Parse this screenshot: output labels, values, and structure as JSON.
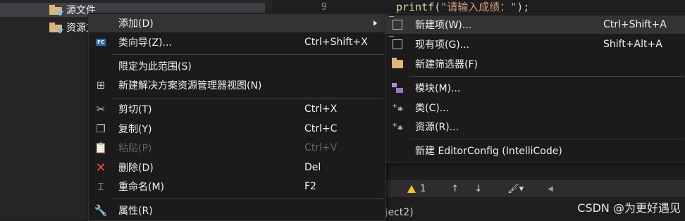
{
  "solution_explorer": {
    "items": [
      {
        "label": "源文件",
        "selected": true
      },
      {
        "label": "资源文件",
        "selected": false
      }
    ]
  },
  "editor": {
    "line_number": "9",
    "code": {
      "fn": "printf",
      "open": "(",
      "string": "\"请输入成绩：\"",
      "close": ");"
    },
    "toolbar": {
      "warning_count": "1",
      "up_arrow": "↑",
      "down_arrow": "↓",
      "brush_icon": "🖌▾",
      "scroll_left": "◀"
    }
  },
  "status_bar": {
    "project_text": "oject2)"
  },
  "watermark": "CSDN @为更好遇见",
  "context_menu": {
    "items": [
      {
        "label": "添加(D)",
        "shortcut": "",
        "icon": "none",
        "submenu": true
      },
      {
        "label": "类向导(Z)...",
        "shortcut": "Ctrl+Shift+X",
        "icon": "class-wizard-icon"
      },
      {
        "label": "限定为此范围(S)",
        "shortcut": "",
        "icon": "none"
      },
      {
        "label": "新建解决方案资源管理器视图(N)",
        "shortcut": "",
        "icon": "new-view-icon"
      },
      {
        "label": "剪切(T)",
        "shortcut": "Ctrl+X",
        "icon": "scissors-icon"
      },
      {
        "label": "复制(Y)",
        "shortcut": "Ctrl+C",
        "icon": "copy-icon"
      },
      {
        "label": "粘贴(P)",
        "shortcut": "Ctrl+V",
        "icon": "paste-icon",
        "disabled": true
      },
      {
        "label": "删除(D)",
        "shortcut": "Del",
        "icon": "delete-icon"
      },
      {
        "label": "重命名(M)",
        "shortcut": "F2",
        "icon": "rename-icon"
      },
      {
        "label": "属性(R)",
        "shortcut": "",
        "icon": "wrench-icon"
      }
    ]
  },
  "add_submenu": {
    "items": [
      {
        "label": "新建项(W)...",
        "shortcut": "Ctrl+Shift+A",
        "icon": "new-item-icon"
      },
      {
        "label": "现有项(G)...",
        "shortcut": "Shift+Alt+A",
        "icon": "existing-item-icon"
      },
      {
        "label": "新建筛选器(F)",
        "shortcut": "",
        "icon": "new-filter-icon"
      },
      {
        "label": "模块(M)...",
        "shortcut": "",
        "icon": "module-icon"
      },
      {
        "label": "类(C)...",
        "shortcut": "",
        "icon": "class-icon"
      },
      {
        "label": "资源(R)...",
        "shortcut": "",
        "icon": "resource-icon"
      },
      {
        "label": "新建 EditorConfig (IntelliCode)",
        "shortcut": "",
        "icon": "none"
      }
    ]
  },
  "colors": {
    "menu_bg": "#1b1b1c",
    "highlight": "#333334",
    "accent_green": "#6ec25f",
    "delete_red": "#f14c4c",
    "warning_yellow": "#f5c518"
  }
}
